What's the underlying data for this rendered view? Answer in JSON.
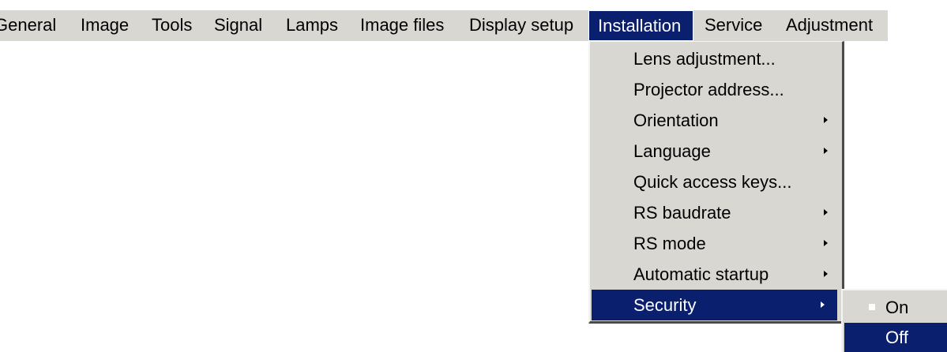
{
  "menubar": {
    "items": [
      {
        "label": "General"
      },
      {
        "label": "Image"
      },
      {
        "label": "Tools"
      },
      {
        "label": "Signal"
      },
      {
        "label": "Lamps"
      },
      {
        "label": "Image files"
      },
      {
        "label": "Display setup"
      },
      {
        "label": "Installation"
      },
      {
        "label": "Service"
      },
      {
        "label": "Adjustment"
      }
    ],
    "active_item": "Installation"
  },
  "installation_menu": {
    "items": [
      {
        "label": "Lens adjustment..."
      },
      {
        "label": "Projector address..."
      },
      {
        "label": "Orientation",
        "submenu": true
      },
      {
        "label": "Language",
        "submenu": true
      },
      {
        "label": "Quick access keys..."
      },
      {
        "label": "RS baudrate",
        "submenu": true
      },
      {
        "label": "RS mode",
        "submenu": true
      },
      {
        "label": "Automatic startup",
        "submenu": true
      },
      {
        "label": "Security",
        "submenu": true
      }
    ],
    "highlighted_item": "Security"
  },
  "security_submenu": {
    "items": [
      {
        "label": "On",
        "checked": false
      },
      {
        "label": "Off",
        "selected": true
      }
    ]
  },
  "colors": {
    "menu_background": "#d9d7d2",
    "highlight": "#0a1f6e",
    "highlight_text": "#ffffff",
    "text": "#000000"
  },
  "icons": {
    "submenu_indicator": "submenu-arrow-icon",
    "option_marker": "checkbox-icon"
  }
}
